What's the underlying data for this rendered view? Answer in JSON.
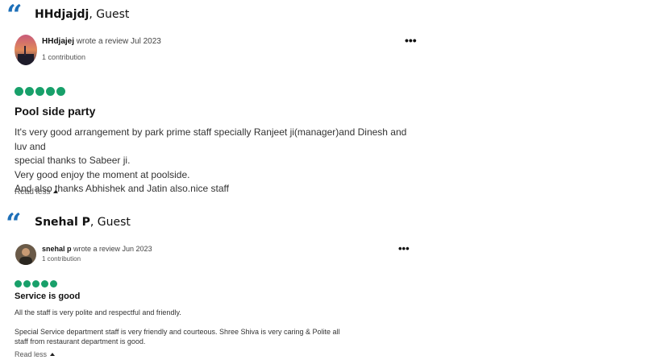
{
  "reviews": [
    {
      "guest_name": "HHdjajdj",
      "guest_suffix": ", Guest",
      "reviewer_name": "HHdjajej",
      "reviewer_action": " wrote a review Jul 2023",
      "contributions": "1 contribution",
      "rating": 5,
      "title": "Pool side party",
      "body": [
        "It's very good arrangement by park prime staff specially Ranjeet ji(manager)and Dinesh and luv and",
        "special thanks to Sabeer ji.",
        "Very good enjoy the moment at poolside.",
        "And also thanks Abhishek and Jatin also.nice staff"
      ],
      "read_less": "Read less"
    },
    {
      "guest_name": "Snehal P",
      "guest_suffix": ", Guest",
      "reviewer_name": "snehal p",
      "reviewer_action": " wrote a review Jun 2023",
      "contributions": "1 contribution",
      "rating": 5,
      "title": "Service is good",
      "body": [
        "All the staff is very polite and respectful and friendly.",
        "",
        "Special Service department staff is very friendly and courteous. Shree Shiva is very caring & Polite all",
        "staff from restaurant department is good."
      ],
      "read_less": "Read less"
    }
  ],
  "colors": {
    "quote": "#1d6fb8",
    "bubble": "#18a06a"
  },
  "icons": {
    "quote": "quote-icon",
    "more": "more-options-icon",
    "caret": "caret-up-icon"
  }
}
